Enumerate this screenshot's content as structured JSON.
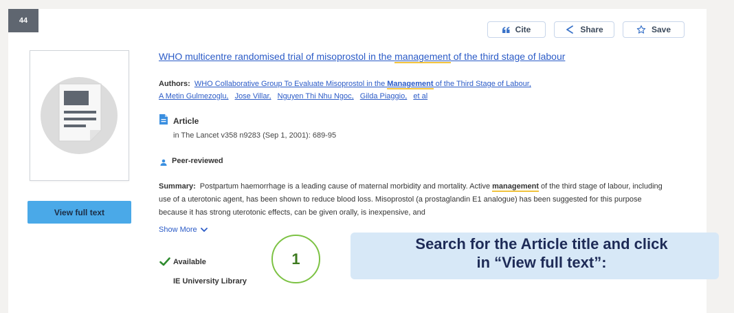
{
  "result": {
    "number": "44"
  },
  "toolbar": {
    "cite_label": "Cite",
    "share_label": "Share",
    "save_label": "Save"
  },
  "record": {
    "title_pre": "WHO multicentre randomised trial of misoprostol in the ",
    "title_hl": "management",
    "title_post": " of the third stage of labour",
    "authors_label": "Authors:",
    "authors_line1_pre": "WHO Collaborative Group To Evaluate Misoprostol in the ",
    "authors_line1_hl": "Management",
    "authors_line1_post": " of the Third Stage of Labour,",
    "authors": [
      "A Metin Gulmezoglu,",
      "Jose Villar,",
      "Nguyen Thi Nhu Ngoc,",
      "Gilda Piaggio,",
      "et al"
    ],
    "type": "Article",
    "source": "in The Lancet   v358 n9283 (Sep 1, 2001): 689-95",
    "peer_reviewed": "Peer-reviewed",
    "summary_label": "Summary:",
    "summary_pre": "Postpartum haemorrhage is a leading cause of maternal morbidity and mortality. Active ",
    "summary_hl": "management",
    "summary_post": " of the third stage of labour, including use of a uterotonic agent, has been shown to reduce blood loss. Misoprostol (a prostaglandin E1 analogue) has been suggested for this purpose because it has strong uterotonic effects, can be given orally, is inexpensive, and",
    "show_more": "Show More",
    "availability": "Available",
    "library": "IE University Library",
    "view_full_text": "View full text"
  },
  "annotation": {
    "step": "1",
    "line1": "Search for the Article title and click",
    "line2": "in “View full text”:"
  },
  "colors": {
    "accent": "#4aa9e8",
    "link": "#2b5bc7",
    "highlight": "#f0c23c",
    "success": "#2e8b2e",
    "step_ring": "#7cc243",
    "callout_bg": "#d7e8f7",
    "callout_text": "#1e2b57"
  }
}
